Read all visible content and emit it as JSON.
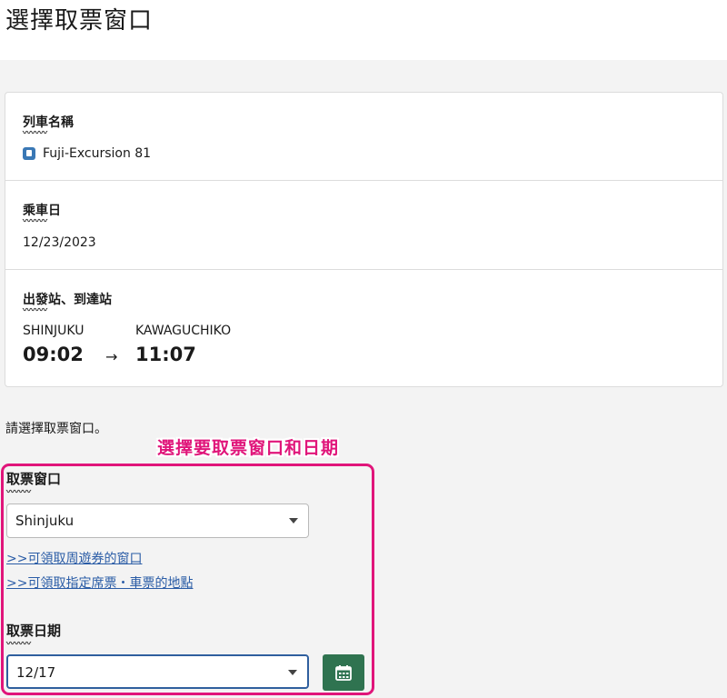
{
  "header": {
    "title": "選擇取票窗口"
  },
  "train_info": {
    "name_label": "列車名稱",
    "name_label_jp": "〰〰〰",
    "train_name": "Fuji-Excursion 81",
    "date_label": "乘車日",
    "date_label_jp": "〰〰〰",
    "date_value": "12/23/2023",
    "stations_label": "出發站、到達站",
    "stations_label_jp": "〰〰〰",
    "departure": {
      "station": "SHINJUKU",
      "time": "09:02"
    },
    "arrow": "→",
    "arrival": {
      "station": "KAWAGUCHIKO",
      "time": "11:07"
    }
  },
  "prompt_text": "請選擇取票窗口。",
  "annotation": "選擇要取票窗口和日期",
  "pickup": {
    "window_label": "取票窗口",
    "window_label_jp": "〰〰〰",
    "window_value": "Shinjuku",
    "link1": ">>可領取周遊券的窗口",
    "link2": ">>可領取指定席票・車票的地點",
    "date_label": "取票日期",
    "date_label_jp": "〰〰〰",
    "date_value": "12/17"
  },
  "icons": {
    "train": "train-icon",
    "calendar": "calendar-icon",
    "dropdown": "chevron-down-icon"
  },
  "colors": {
    "accent_green": "#2f7350",
    "annotation_pink": "#e0157a",
    "link_blue": "#2a5ca6"
  }
}
